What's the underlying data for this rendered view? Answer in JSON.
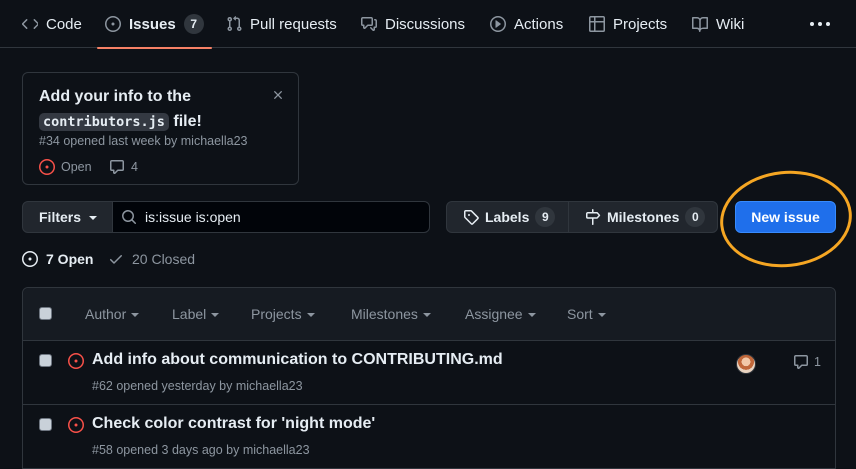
{
  "nav": {
    "tabs": [
      {
        "label": "Code",
        "icon": "code-icon"
      },
      {
        "label": "Issues",
        "icon": "issue-opened-icon",
        "count": "7",
        "active": true
      },
      {
        "label": "Pull requests",
        "icon": "git-pull-request-icon"
      },
      {
        "label": "Discussions",
        "icon": "comment-discussion-icon"
      },
      {
        "label": "Actions",
        "icon": "play-icon"
      },
      {
        "label": "Projects",
        "icon": "table-icon"
      },
      {
        "label": "Wiki",
        "icon": "book-icon"
      }
    ],
    "more_icon": "kebab-horizontal-icon"
  },
  "card": {
    "title_prefix": "Add your info to the",
    "title_code": "contributors.js",
    "title_suffix": "file!",
    "meta": "#34 opened last week by michaella23",
    "status": "Open",
    "comments": "4"
  },
  "filterbar": {
    "filters_label": "Filters",
    "search_value": "is:issue is:open",
    "labels_label": "Labels",
    "labels_count": "9",
    "milestones_label": "Milestones",
    "milestones_count": "0",
    "new_issue_label": "New issue"
  },
  "states": {
    "open_label": "7 Open",
    "closed_label": "20 Closed"
  },
  "list_header": {
    "filters": [
      "Author",
      "Label",
      "Projects",
      "Milestones",
      "Assignee",
      "Sort"
    ]
  },
  "issues": [
    {
      "title": "Add info about communication to CONTRIBUTING.md",
      "meta": "#62 opened yesterday by michaella23",
      "comments": "1",
      "has_avatar": true
    },
    {
      "title": "Check color contrast for 'night mode'",
      "meta": "#58 opened 3 days ago by michaella23",
      "comments": "",
      "has_avatar": false
    }
  ],
  "colors": {
    "background": "#0d1117",
    "accent_tab": "#f78166",
    "primary_button": "#1f6feb",
    "open_issue": "#f85149",
    "highlight_ring": "#f5a623"
  }
}
